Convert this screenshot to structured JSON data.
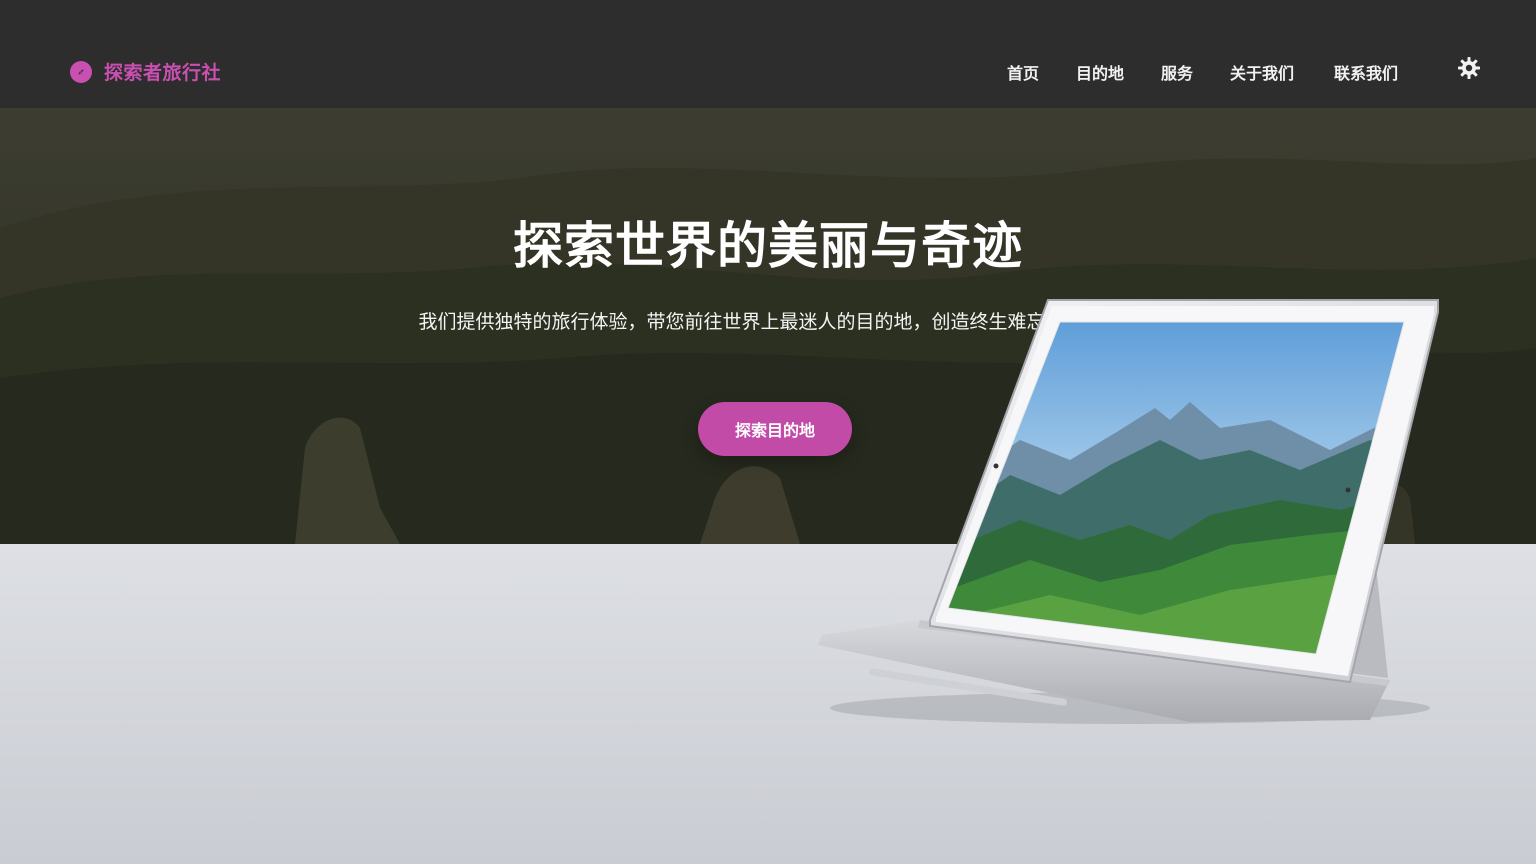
{
  "brand": {
    "name": "探索者旅行社",
    "icon": "compass-icon",
    "color": "#c94fb1"
  },
  "nav": {
    "items": [
      {
        "label": "首页"
      },
      {
        "label": "目的地"
      },
      {
        "label": "服务"
      },
      {
        "label": "关于我们"
      },
      {
        "label": "联系我们"
      }
    ],
    "theme_icon": "gear-icon"
  },
  "hero": {
    "title": "探索世界的美丽与奇迹",
    "subtitle": "我们提供独特的旅行体验，带您前往世界上最迷人的目的地，创造终生难忘的回忆。",
    "cta_label": "探索目的地",
    "cta_color": "#c24ba8"
  }
}
